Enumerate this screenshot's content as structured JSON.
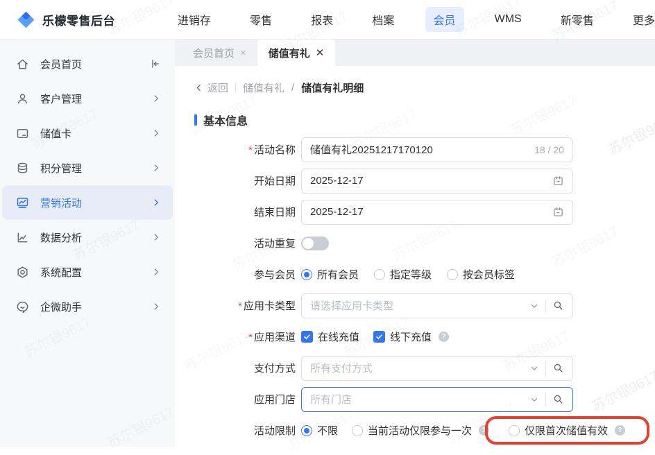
{
  "app": {
    "title": "乐檬零售后台"
  },
  "nav": {
    "items": [
      {
        "label": "进销存",
        "active": false
      },
      {
        "label": "零售",
        "active": false
      },
      {
        "label": "报表",
        "active": false
      },
      {
        "label": "档案",
        "active": false
      },
      {
        "label": "会员",
        "active": true
      },
      {
        "label": "WMS",
        "active": false
      },
      {
        "label": "新零售",
        "active": false
      },
      {
        "label": "更多",
        "active": false
      }
    ]
  },
  "sidebar": {
    "items": [
      {
        "label": "会员首页",
        "icon": "home-icon",
        "active": false
      },
      {
        "label": "客户管理",
        "icon": "user-icon",
        "active": false
      },
      {
        "label": "储值卡",
        "icon": "stored-value-card-icon",
        "active": false
      },
      {
        "label": "积分管理",
        "icon": "points-icon",
        "active": false
      },
      {
        "label": "营销活动",
        "icon": "marketing-icon",
        "active": true
      },
      {
        "label": "数据分析",
        "icon": "analytics-icon",
        "active": false
      },
      {
        "label": "系统配置",
        "icon": "settings-icon",
        "active": false
      },
      {
        "label": "企微助手",
        "icon": "wecom-assistant-icon",
        "active": false
      }
    ]
  },
  "tabs": [
    {
      "label": "会员首页",
      "close": "×",
      "active": false
    },
    {
      "label": "储值有礼",
      "close": "✕",
      "active": true
    }
  ],
  "breadcrumb": {
    "back": "返回",
    "divider": "|",
    "parent": "储值有礼",
    "separator": "/",
    "current": "储值有礼明细"
  },
  "section": {
    "title": "基本信息"
  },
  "form": {
    "required_mark": "*",
    "activity_name": {
      "label": "活动名称",
      "value": "储值有礼20251217170120",
      "counter": "18 / 20"
    },
    "start_date": {
      "label": "开始日期",
      "value": "2025-12-17"
    },
    "end_date": {
      "label": "结束日期",
      "value": "2025-12-17"
    },
    "repeat": {
      "label": "活动重复",
      "state": "off"
    },
    "member_scope": {
      "label": "参与会员",
      "options": [
        {
          "label": "所有会员",
          "selected": true
        },
        {
          "label": "指定等级",
          "selected": false
        },
        {
          "label": "按会员标签",
          "selected": false
        }
      ]
    },
    "card_type": {
      "label": "应用卡类型",
      "placeholder": "请选择应用卡类型"
    },
    "channels": {
      "label": "应用渠道",
      "options": [
        {
          "label": "在线充值",
          "checked": true
        },
        {
          "label": "线下充值",
          "checked": true
        }
      ]
    },
    "payment": {
      "label": "支付方式",
      "placeholder": "所有支付方式"
    },
    "stores": {
      "label": "应用门店",
      "placeholder": "所有门店"
    },
    "limit": {
      "label": "活动限制",
      "options": [
        {
          "label": "不限",
          "selected": true
        },
        {
          "label": "当前活动仅限参与一次",
          "selected": false
        },
        {
          "label": "仅限首次储值有效",
          "selected": false
        }
      ]
    }
  },
  "watermark": {
    "text": "苏尔银9617"
  },
  "colors": {
    "primary": "#3276f5",
    "annotation": "#e8402e",
    "required": "#f34b44"
  }
}
